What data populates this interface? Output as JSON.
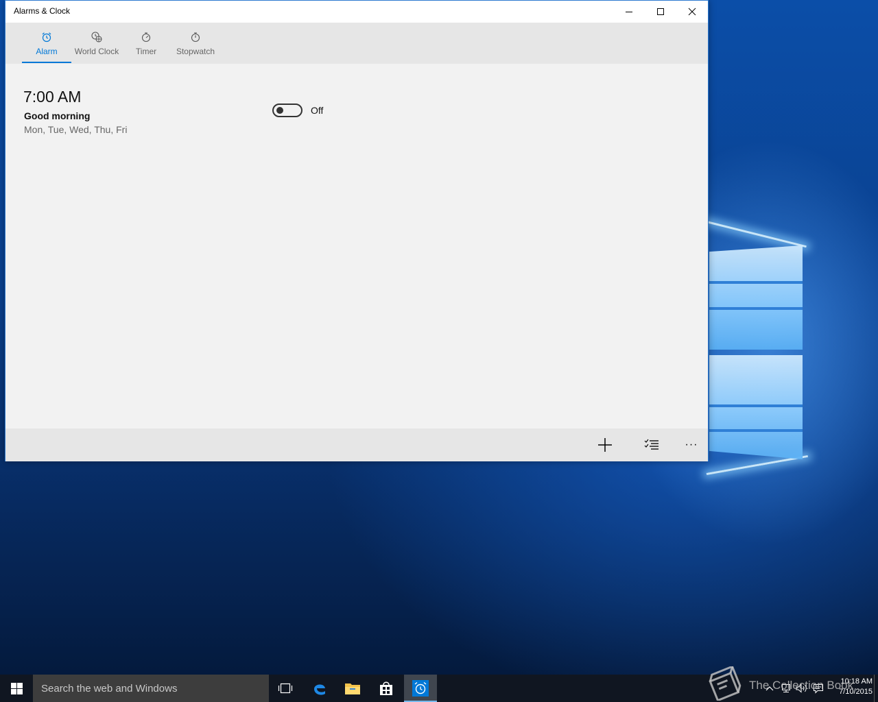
{
  "window": {
    "title": "Alarms & Clock"
  },
  "tabs": [
    {
      "label": "Alarm",
      "icon": "alarm-clock-icon",
      "active": true
    },
    {
      "label": "World Clock",
      "icon": "world-clock-icon",
      "active": false
    },
    {
      "label": "Timer",
      "icon": "timer-icon",
      "active": false
    },
    {
      "label": "Stopwatch",
      "icon": "stopwatch-icon",
      "active": false
    }
  ],
  "alarms": [
    {
      "time": "7:00 AM",
      "name": "Good morning",
      "days": "Mon, Tue, Wed, Thu, Fri",
      "enabled": false,
      "toggle_label": "Off"
    }
  ],
  "command_bar": {
    "new_icon": "plus-icon",
    "select_icon": "select-list-icon",
    "more_icon": "more-ellipsis-icon",
    "more_label": "···"
  },
  "taskbar": {
    "search_placeholder": "Search the web and Windows",
    "pinned": [
      "task-view-icon",
      "edge-icon",
      "file-explorer-icon",
      "store-icon",
      "alarms-icon"
    ],
    "clock_time": "10:18 AM",
    "clock_date": "7/10/2015"
  },
  "watermark": {
    "text": "The Collection Book"
  },
  "colors": {
    "accent": "#0078d7",
    "window_bg": "#f2f2f2",
    "tab_strip_bg": "#e6e6e6",
    "taskbar_bg": "#101621"
  }
}
